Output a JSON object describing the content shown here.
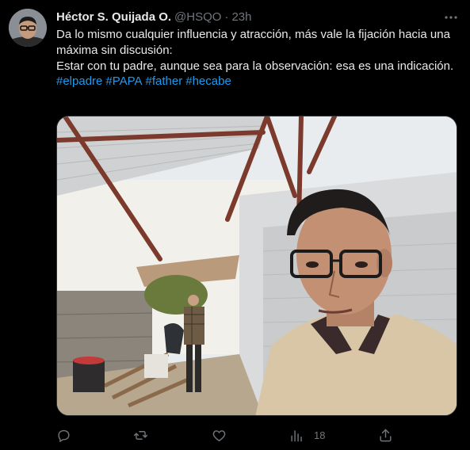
{
  "author": {
    "display_name": "Héctor S. Quijada O.",
    "handle": "@HSQO",
    "separator": "·",
    "time": "23h"
  },
  "tweet": {
    "lines": [
      "Da lo mismo cualquier influencia y atracción, más vale la fijación hacia una máxima sin discusión:",
      "Estar con tu padre, aunque sea para la observación: esa es una indicación."
    ],
    "hashtags": [
      "#elpadre",
      "#PAPA",
      "#father",
      "#hecabe"
    ]
  },
  "actions": {
    "reply_count": "",
    "retweet_count": "",
    "like_count": "",
    "views_count": "18"
  },
  "colors": {
    "background": "#000000",
    "text": "#e7e9ea",
    "muted": "#71767b",
    "link": "#1d9bf0"
  },
  "icons": {
    "more": "more-dots-icon",
    "reply": "reply-icon",
    "retweet": "retweet-icon",
    "like": "heart-icon",
    "views": "views-chart-icon",
    "share": "share-icon"
  }
}
